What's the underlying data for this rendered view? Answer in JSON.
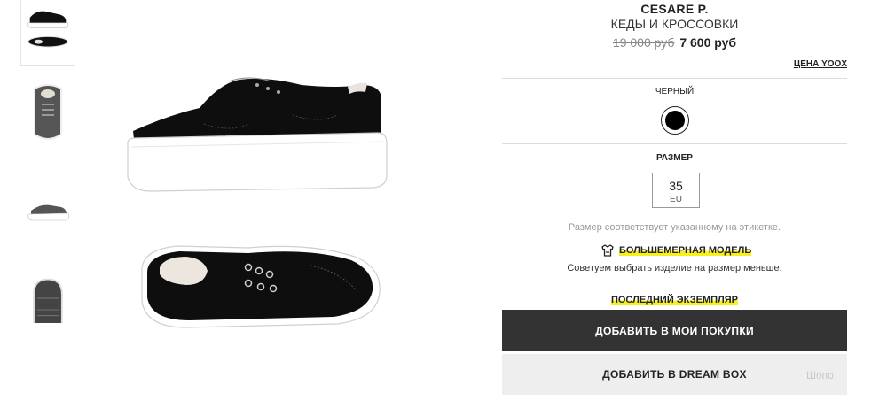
{
  "gallery": {
    "thumbnails": [
      {
        "alt": "side-and-top-view"
      },
      {
        "alt": "top-grey-view"
      },
      {
        "alt": "side-grey-view"
      },
      {
        "alt": "sole-view"
      }
    ]
  },
  "product": {
    "brand": "CESARE P.",
    "category": "КЕДЫ И КРОССОВКИ",
    "price_old": "19 000 руб",
    "price_new": "7 600 руб",
    "yoox_price_link": "ЦЕНА YOOX"
  },
  "color": {
    "label": "ЧЕРНЫЙ",
    "swatch": "#000000"
  },
  "size": {
    "label": "РАЗМЕР",
    "value": "35",
    "unit": "EU",
    "note": "Размер соответствует указанному на этикетке.",
    "fit_label": "БОЛЬШЕМЕРНАЯ МОДЕЛЬ",
    "fit_advice": "Советуем выбрать изделие на размер меньше.",
    "last_item": "ПОСЛЕДНИЙ ЭКЗЕМПЛЯР"
  },
  "actions": {
    "add_to_cart": "ДОБАВИТЬ В МОИ ПОКУПКИ",
    "add_to_dreambox": "ДОБАВИТЬ В DREAM BOX"
  },
  "watermark": "Шопо",
  "colors": {
    "cart_button_bg": "#333333",
    "dream_button_bg": "#eeeeee",
    "highlight": "#f7f01c"
  }
}
